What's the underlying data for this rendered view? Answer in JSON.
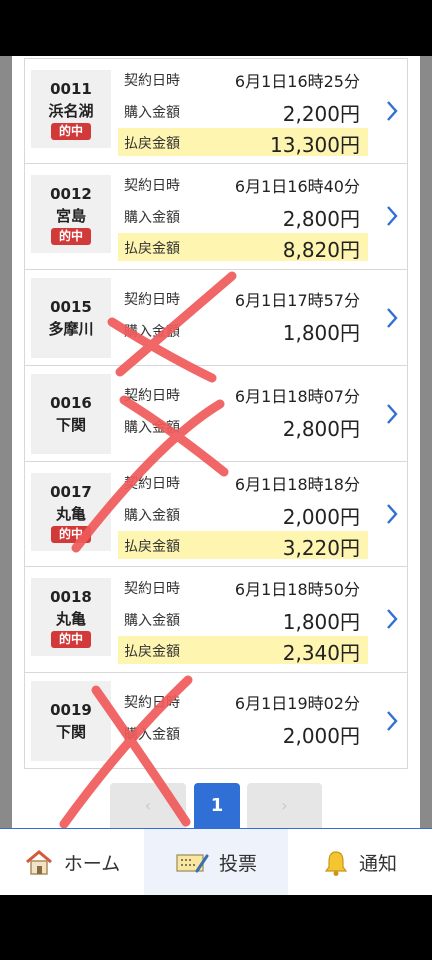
{
  "labels": {
    "contract": "契約日時",
    "purchase": "購入金額",
    "payout": "払戻金額",
    "hit": "的中"
  },
  "rows": [
    {
      "id": "0011",
      "venue": "浜名湖",
      "hit": true,
      "datetime": "6月1日16時25分",
      "purchase": "2,200円",
      "payout": "13,300円"
    },
    {
      "id": "0012",
      "venue": "宮島",
      "hit": true,
      "datetime": "6月1日16時40分",
      "purchase": "2,800円",
      "payout": "8,820円"
    },
    {
      "id": "0015",
      "venue": "多摩川",
      "hit": false,
      "datetime": "6月1日17時57分",
      "purchase": "1,800円"
    },
    {
      "id": "0016",
      "venue": "下関",
      "hit": false,
      "datetime": "6月1日18時07分",
      "purchase": "2,800円"
    },
    {
      "id": "0017",
      "venue": "丸亀",
      "hit": true,
      "datetime": "6月1日18時18分",
      "purchase": "2,000円",
      "payout": "3,220円"
    },
    {
      "id": "0018",
      "venue": "丸亀",
      "hit": true,
      "datetime": "6月1日18時50分",
      "purchase": "1,800円",
      "payout": "2,340円"
    },
    {
      "id": "0019",
      "venue": "下関",
      "hit": false,
      "datetime": "6月1日19時02分",
      "purchase": "2,000円"
    }
  ],
  "pagination": {
    "prev": "‹",
    "current": "1",
    "next": "›"
  },
  "tabbar": {
    "home": "ホーム",
    "vote": "投票",
    "notice": "通知"
  },
  "colors": {
    "accent": "#2f6fd6",
    "hit_badge": "#d23a3a",
    "payout_highlight": "#fdf5b0",
    "cross_mark": "#f05a5a"
  }
}
